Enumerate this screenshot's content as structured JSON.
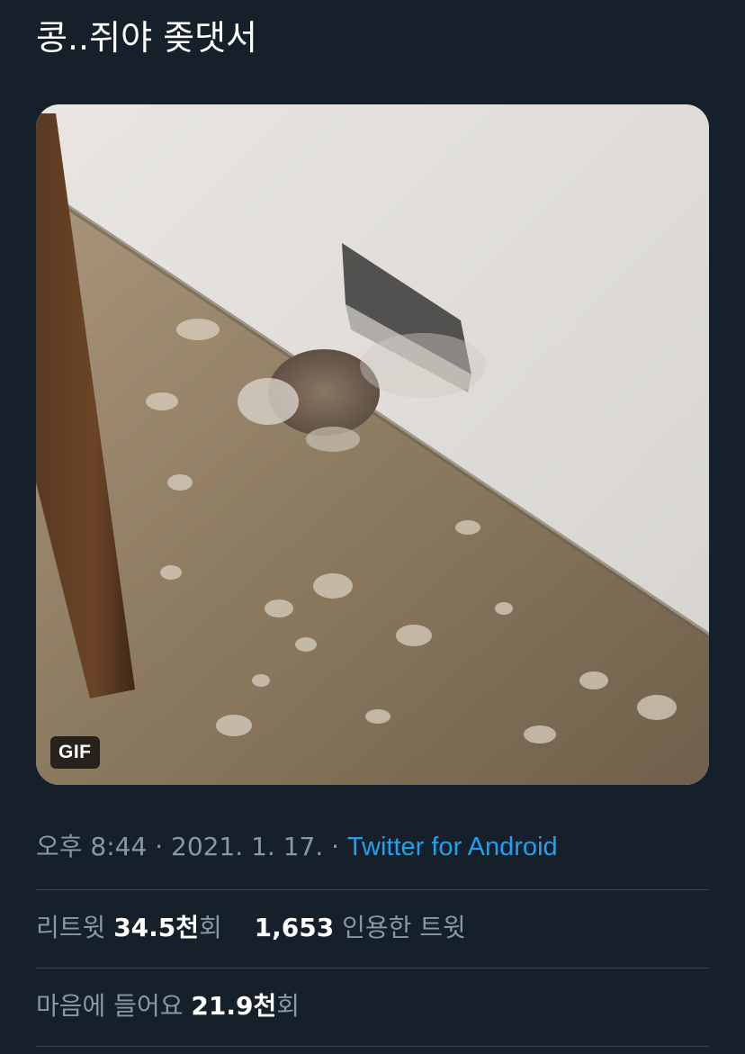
{
  "tweet": {
    "text": "콩..쥐야 좆댓서"
  },
  "media": {
    "badge": "GIF"
  },
  "meta": {
    "time": "오후 8:44",
    "sep1": " · ",
    "date": "2021. 1. 17.",
    "sep2": " · ",
    "source": "Twitter for Android"
  },
  "stats": {
    "retweets_label": "리트윗 ",
    "retweets_value": "34.5천",
    "retweets_unit": "회",
    "quotes_value": "1,653",
    "quotes_label": " 인용한 트윗",
    "likes_label": "마음에 들어요 ",
    "likes_value": "21.9천",
    "likes_unit": "회"
  }
}
